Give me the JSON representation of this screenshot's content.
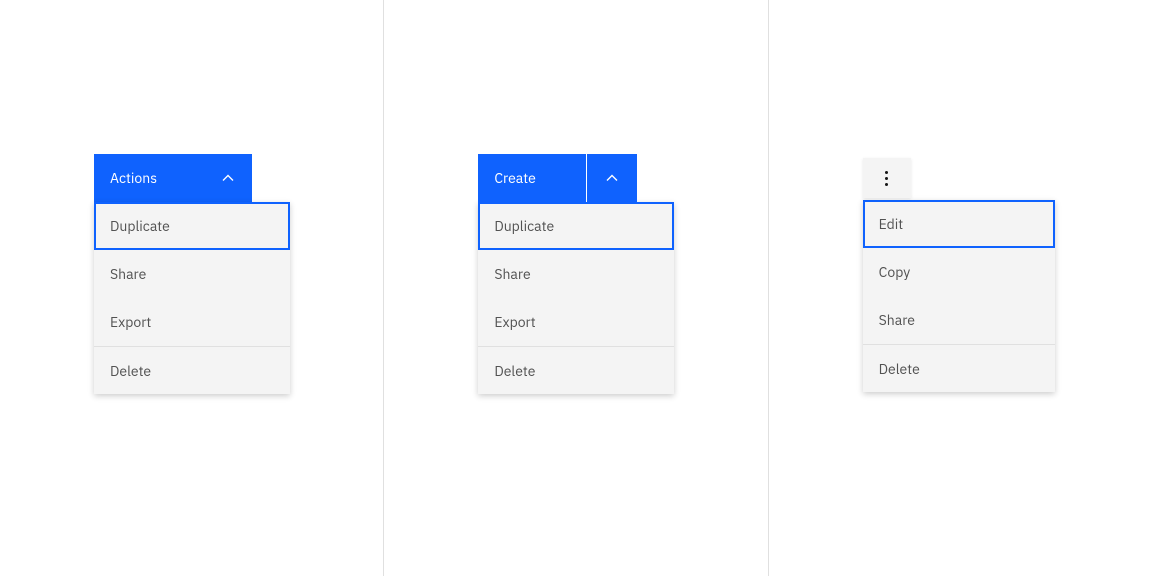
{
  "columns": {
    "combo": {
      "button_label": "Actions",
      "items": [
        "Duplicate",
        "Share",
        "Export",
        "Delete"
      ]
    },
    "split": {
      "button_label": "Create",
      "items": [
        "Duplicate",
        "Share",
        "Export",
        "Delete"
      ]
    },
    "overflow": {
      "items": [
        "Edit",
        "Copy",
        "Share",
        "Delete"
      ]
    }
  }
}
